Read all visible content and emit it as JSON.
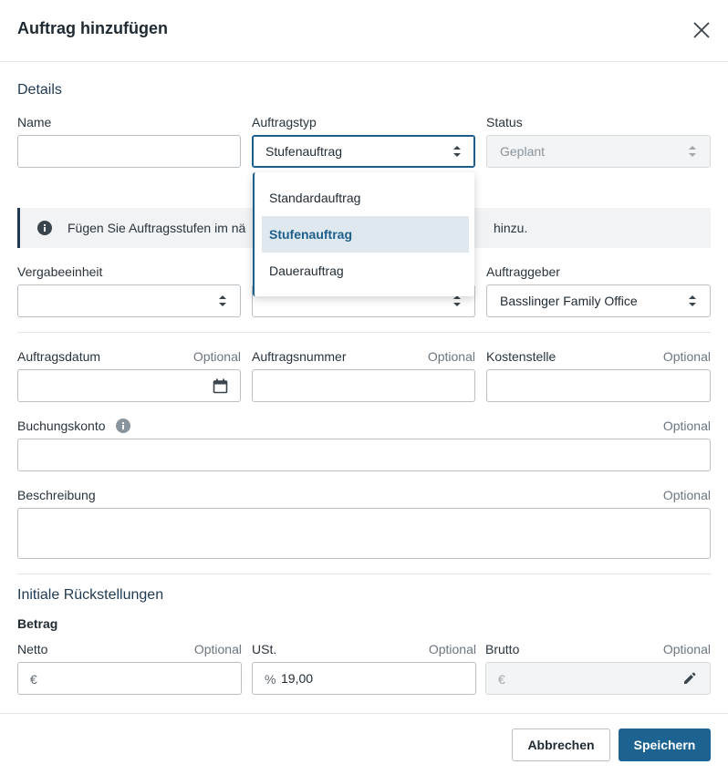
{
  "modal": {
    "title": "Auftrag hinzufügen"
  },
  "details": {
    "title": "Details",
    "name": {
      "label": "Name",
      "value": ""
    },
    "auftragstyp": {
      "label": "Auftragstyp",
      "value": "Stufenauftrag"
    },
    "status": {
      "label": "Status",
      "value": "Geplant"
    },
    "info": {
      "text": "Fügen Sie Auftragsstufen im nä",
      "text_end": "hinzu."
    },
    "vergabeeinheit": {
      "label": "Vergabeeinheit",
      "value": ""
    },
    "middle_select": {
      "value": ""
    },
    "auftraggeber": {
      "label": "Auftraggeber",
      "value": "Basslinger Family Office"
    },
    "auftragsdatum": {
      "label": "Auftragsdatum",
      "optional": "Optional"
    },
    "auftragsnummer": {
      "label": "Auftragsnummer",
      "optional": "Optional"
    },
    "kostenstelle": {
      "label": "Kostenstelle",
      "optional": "Optional"
    },
    "buchungskonto": {
      "label": "Buchungskonto",
      "optional": "Optional"
    },
    "beschreibung": {
      "label": "Beschreibung",
      "optional": "Optional"
    }
  },
  "dropdown": {
    "options": [
      "Standardauftrag",
      "Stufenauftrag",
      "Dauerauftrag"
    ],
    "selected": "Stufenauftrag"
  },
  "rueckstellungen": {
    "title": "Initiale Rückstellungen",
    "betrag_label": "Betrag",
    "netto": {
      "label": "Netto",
      "optional": "Optional",
      "prefix": "€",
      "value": ""
    },
    "ust": {
      "label": "USt.",
      "optional": "Optional",
      "prefix": "%",
      "value": "19,00"
    },
    "brutto": {
      "label": "Brutto",
      "optional": "Optional",
      "prefix": "€",
      "value": ""
    }
  },
  "footer": {
    "cancel_label": "Abbrechen",
    "save_label": "Speichern"
  },
  "colors": {
    "primary": "#1d6391",
    "selected_bg": "#dfe8ee",
    "banner_bg": "#f1f3f5"
  }
}
